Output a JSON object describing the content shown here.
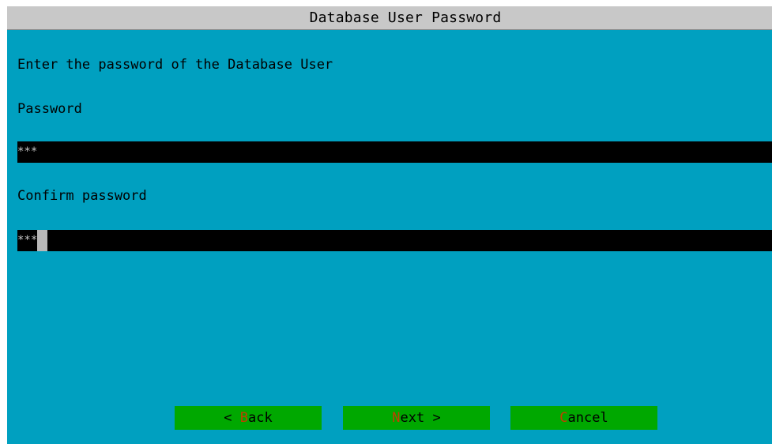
{
  "window": {
    "title": "Database User Password"
  },
  "dialog": {
    "prompt": "Enter the password of the Database User",
    "password_label": "Password",
    "password_value": "***",
    "confirm_label": "Confirm password",
    "confirm_value": "***"
  },
  "buttons": {
    "back": {
      "prefix": "< ",
      "hotkey": "B",
      "rest": "ack"
    },
    "next": {
      "prefix": "",
      "hotkey": "N",
      "rest": "ext >"
    },
    "cancel": {
      "prefix": "",
      "hotkey": "C",
      "rest": "ancel"
    }
  },
  "colors": {
    "background": "#00a0c0",
    "titlebar": "#c8c8c8",
    "field": "#000000",
    "button": "#00a800",
    "hotkey": "#c04000"
  }
}
